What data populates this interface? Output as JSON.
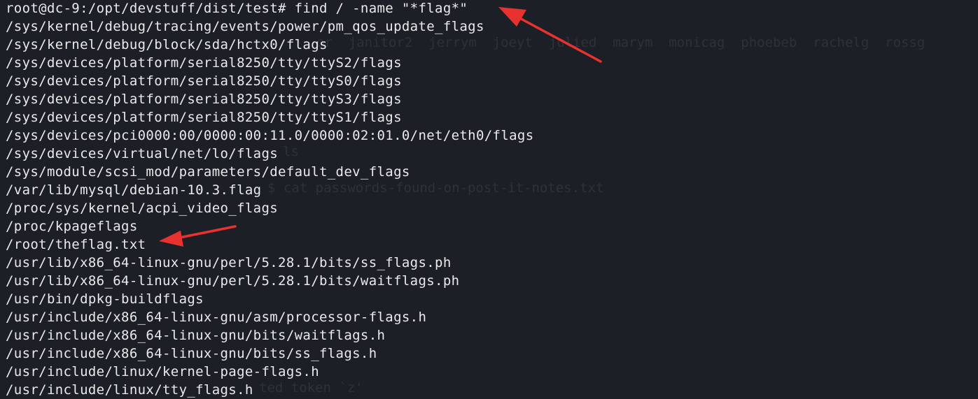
{
  "terminal": {
    "prompt": "root@dc-9:/opt/devstuff/dist/test#",
    "command": " find / -name \"*flag*\"",
    "lines": [
      "/sys/kernel/debug/tracing/events/power/pm_qos_update_flags",
      "/sys/kernel/debug/block/sda/hctx0/flags",
      "/sys/devices/platform/serial8250/tty/ttyS2/flags",
      "/sys/devices/platform/serial8250/tty/ttyS0/flags",
      "/sys/devices/platform/serial8250/tty/ttyS3/flags",
      "/sys/devices/platform/serial8250/tty/ttyS1/flags",
      "/sys/devices/pci0000:00/0000:00:11.0/0000:02:01.0/net/eth0/flags",
      "/sys/devices/virtual/net/lo/flags",
      "/sys/module/scsi_mod/parameters/default_dev_flags",
      "/var/lib/mysql/debian-10.3.flag",
      "/proc/sys/kernel/acpi_video_flags",
      "/proc/kpageflags",
      "/root/theflag.txt",
      "/usr/lib/x86_64-linux-gnu/perl/5.28.1/bits/ss_flags.ph",
      "/usr/lib/x86_64-linux-gnu/perl/5.28.1/bits/waitflags.ph",
      "/usr/bin/dpkg-buildflags",
      "/usr/include/x86_64-linux-gnu/asm/processor-flags.h",
      "/usr/include/x86_64-linux-gnu/bits/waitflags.h",
      "/usr/include/x86_64-linux-gnu/bits/ss_flags.h",
      "/usr/include/linux/kernel-page-flags.h",
      "/usr/include/linux/tty_flags.h"
    ]
  },
  "background_ghost": {
    "users_row": "or  janitor2  jerrym  joeyt  julied  marym  monicag  phoebeb  rachelg  rossg",
    "ls_fragment": "ls",
    "cat_fragment": "$ cat passwords-found-on-post-it-notes.txt",
    "token_fragment": "ted token `z'"
  },
  "annotations": {
    "arrow_color": "#e8322f"
  }
}
